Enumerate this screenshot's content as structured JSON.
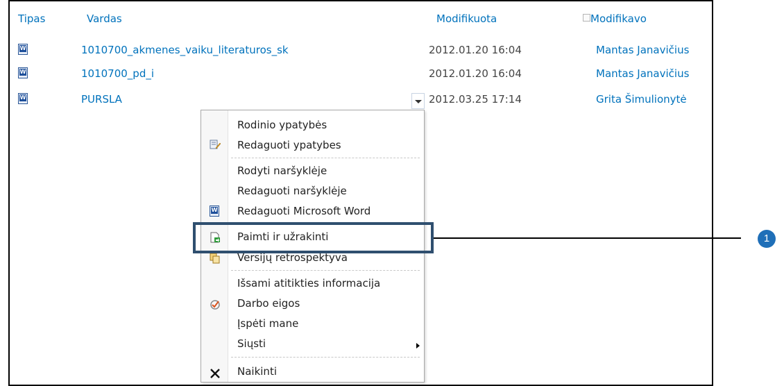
{
  "columns": {
    "type": "Tipas",
    "name": "Vardas",
    "modified": "Modifikuota",
    "modified_by": "Modifikavo"
  },
  "rows": [
    {
      "name": "1010700_akmenes_vaiku_literaturos_sk",
      "date": "2012.01.20 16:04",
      "author": "Mantas Janavičius",
      "icon": "word-doc-icon"
    },
    {
      "name": "1010700_pd_i",
      "date": "2012.01.20 16:04",
      "author": "Mantas Janavičius",
      "icon": "word-doc-icon"
    },
    {
      "name": "PURSLA",
      "date": "2012.03.25 17:14",
      "author": "Grita Šimulionytė",
      "icon": "word-doc-icon"
    }
  ],
  "menu": {
    "items": [
      {
        "label": "Rodinio ypatybės",
        "icon": ""
      },
      {
        "label": "Redaguoti ypatybes",
        "icon": "edit-properties-icon"
      },
      {
        "label": "Rodyti naršyklėje",
        "icon": ""
      },
      {
        "label": "Redaguoti naršyklėje",
        "icon": ""
      },
      {
        "label": "Redaguoti Microsoft Word",
        "icon": "word-doc-icon"
      },
      {
        "label": "Paimti ir užrakinti",
        "icon": "check-out-icon"
      },
      {
        "label": "Versijų retrospektyva",
        "icon": "version-history-icon"
      },
      {
        "label": "Išsami atitikties informacija",
        "icon": ""
      },
      {
        "label": "Darbo eigos",
        "icon": "workflow-icon"
      },
      {
        "label": "Įspėti mane",
        "icon": ""
      },
      {
        "label": "Siųsti",
        "icon": ""
      },
      {
        "label": "Naikinti",
        "icon": "delete-icon"
      }
    ]
  },
  "callout": {
    "number": "1"
  },
  "colors": {
    "link": "#0072bc",
    "highlight_border": "#2f4f6f",
    "badge": "#1f6fb8"
  }
}
